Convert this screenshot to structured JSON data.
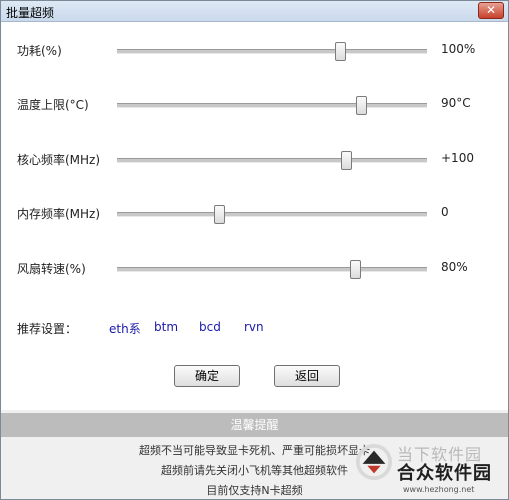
{
  "window": {
    "title": "批量超频",
    "close_glyph": "✕"
  },
  "sliders": [
    {
      "label": "功耗(%)",
      "value": "100%",
      "level": 0.72
    },
    {
      "label": "温度上限(°C)",
      "value": "90°C",
      "level": 0.79
    },
    {
      "label": "核心频率(MHz)",
      "value": "+100",
      "level": 0.74
    },
    {
      "label": "内存频率(MHz)",
      "value": "0",
      "level": 0.33
    },
    {
      "label": "风扇转速(%)",
      "value": "80%",
      "level": 0.77
    }
  ],
  "recommend": {
    "label": "推荐设置：",
    "options": [
      "eth系",
      "btm",
      "bcd",
      "rvn"
    ]
  },
  "buttons": {
    "ok": "确定",
    "back": "返回"
  },
  "tips": {
    "header": "温馨提醒",
    "lines": [
      "超频不当可能导致显卡死机、严重可能损坏显卡",
      "超频前请先关闭小飞机等其他超频软件",
      "目前仅支持N卡超频"
    ]
  },
  "watermark": {
    "text1": "当下软件园",
    "text2": "合众软件园",
    "url": "www.hezhong.net"
  },
  "colors": {
    "link": "#1a1aa8",
    "tips_bar": "#bcbcbc"
  }
}
